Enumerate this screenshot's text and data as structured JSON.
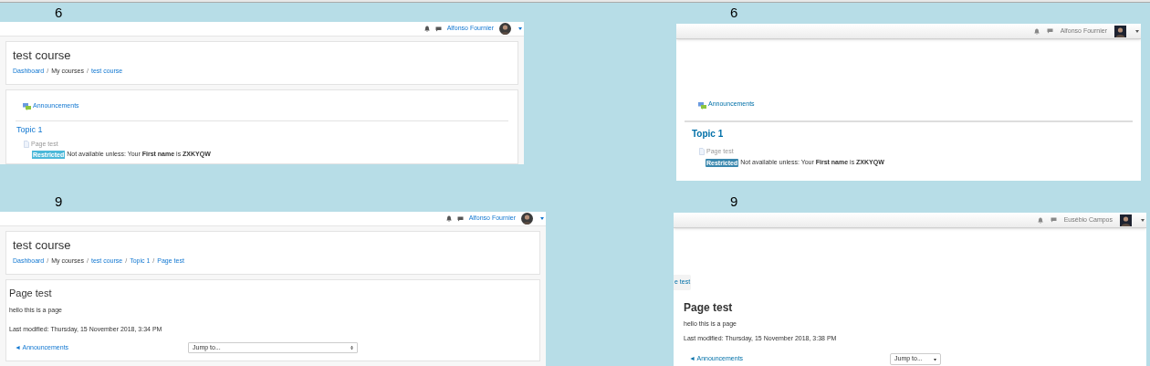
{
  "panels": [
    {
      "label": "6",
      "classic": false,
      "kind": "course",
      "user": "Alfonso Fournier",
      "title": "test course",
      "separator": "/",
      "breadcrumb": [
        {
          "text": "Dashboard",
          "link": true
        },
        {
          "text": "My courses",
          "link": false
        },
        {
          "text": "test course",
          "link": true
        }
      ],
      "activity": "Announcements",
      "section": "Topic 1",
      "item": "Page test",
      "badge": "Restricted",
      "restriction": "Not available unless: Your **First name** is **ZXKYQW**"
    },
    {
      "label": "6",
      "classic": true,
      "kind": "course",
      "user": "Alfonso Fournier",
      "activity": "Announcements",
      "section": "Topic 1",
      "item": "Page test",
      "badge": "Restricted",
      "restriction": "Not available unless: Your **First name** is **ZXKYQW**"
    },
    {
      "label": "9",
      "classic": false,
      "kind": "page",
      "user": "Alfonso Fournier",
      "title": "test course",
      "separator": "/",
      "breadcrumb": [
        {
          "text": "Dashboard",
          "link": true
        },
        {
          "text": "My courses",
          "link": false
        },
        {
          "text": "test course",
          "link": true
        },
        {
          "text": "Topic 1",
          "link": true
        },
        {
          "text": "Page test",
          "link": true
        }
      ],
      "heading": "Page test",
      "body": "hello this is a page",
      "modified": "Last modified: Thursday, 15 November 2018, 3:34 PM",
      "prev": "◄ Announcements",
      "jump": "Jump to..."
    },
    {
      "label": "9",
      "classic": true,
      "kind": "page",
      "user": "Eusébio Campos",
      "tab": "e test",
      "heading": "Page test",
      "body": "hello this is a page",
      "modified": "Last modified: Thursday, 15 November 2018, 3:38 PM",
      "prev": "◄ Announcements",
      "jump": "Jump to..."
    }
  ]
}
